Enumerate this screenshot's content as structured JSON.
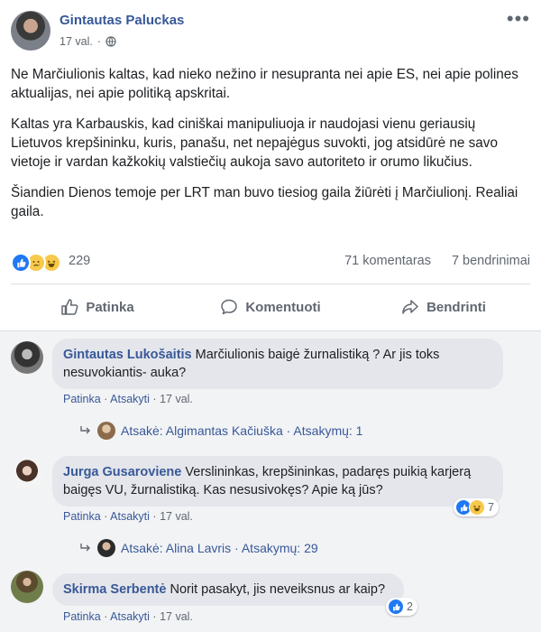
{
  "post": {
    "author": "Gintautas Paluckas",
    "time": "17 val.",
    "meta_sep": "·",
    "paragraphs": [
      "Ne Marčiulionis kaltas, kad nieko nežino ir nesupranta nei apie ES, nei apie polines aktualijas, nei apie politiką apskritai.",
      "Kaltas yra Karbauskis, kad ciniškai manipuliuoja ir naudojasi vienu geriausių Lietuvos krepšininku, kuris, panašu, net nepajėgus suvokti, jog atsidūrė ne savo vietoje ir vardan kažkokių valstiečių aukoja savo autoriteto ir orumo likučius.",
      "Šiandien Dienos temoje per LRT man buvo tiesiog gaila žiūrėti į Marčiulionį. Realiai gaila."
    ],
    "reaction_count": "229",
    "comment_count": "71 komentaras",
    "share_count": "7 bendrinimai"
  },
  "actions": {
    "like": "Patinka",
    "comment": "Komentuoti",
    "share": "Bendrinti"
  },
  "comments": [
    {
      "name": "Gintautas Lukošaitis",
      "text": "Marčiulionis baigė žurnalistiką ? Ar jis toks nesuvokiantis- auka?",
      "like": "Patinka",
      "reply": "Atsakyti",
      "time": "17 val.",
      "reply_summary": "Atsakė: Algimantas Kačiuška · Atsakymų: 1"
    },
    {
      "name": "Jurga Gusaroviene",
      "text": "Verslininkas, krepšininkas, padaręs puikią karjerą baigęs VU, žurnalistiką. Kas nesusivokęs? Apie ką jūs?",
      "like": "Patinka",
      "reply": "Atsakyti",
      "time": "17 val.",
      "reactions": "7",
      "reply_summary": "Atsakė: Alina Lavris · Atsakymų: 29"
    },
    {
      "name": "Skirma Serbentė",
      "text": "Norit pasakyt, jis neveiksnus ar kaip?",
      "like": "Patinka",
      "reply": "Atsakyti",
      "time": "17 val.",
      "reactions": "2"
    }
  ],
  "sep": "·",
  "colors": {
    "link": "#385898",
    "secondary": "#606770",
    "like_blue": "#2078f4",
    "bubble": "#e4e6eb",
    "comments_bg": "#f2f3f5"
  },
  "icons": [
    "globe-icon",
    "more-options-icon",
    "like-reaction-icon",
    "sad-reaction-icon",
    "haha-reaction-icon",
    "thumbs-up-icon",
    "comment-icon",
    "share-icon",
    "reply-arrow-icon"
  ]
}
